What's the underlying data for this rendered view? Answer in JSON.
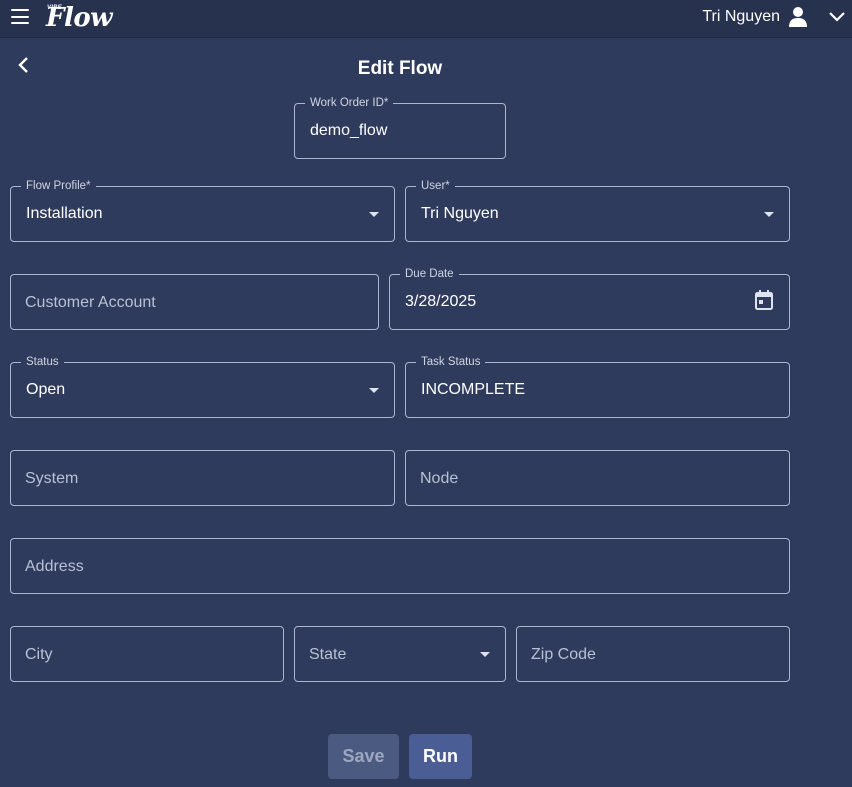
{
  "header": {
    "logo_small": "VIBE",
    "logo_main": "Flow",
    "user_name": "Tri Nguyen"
  },
  "page": {
    "title": "Edit Flow"
  },
  "form": {
    "work_order_id": {
      "label": "Work Order ID*",
      "value": "demo_flow"
    },
    "flow_profile": {
      "label": "Flow Profile*",
      "value": "Installation"
    },
    "user": {
      "label": "User*",
      "value": "Tri Nguyen"
    },
    "customer_account": {
      "placeholder": "Customer Account"
    },
    "due_date": {
      "label": "Due Date",
      "value": "3/28/2025"
    },
    "status": {
      "label": "Status",
      "value": "Open"
    },
    "task_status": {
      "label": "Task Status",
      "value": "INCOMPLETE"
    },
    "system": {
      "placeholder": "System"
    },
    "node": {
      "placeholder": "Node"
    },
    "address": {
      "placeholder": "Address"
    },
    "city": {
      "placeholder": "City"
    },
    "state": {
      "placeholder": "State"
    },
    "zip_code": {
      "placeholder": "Zip Code"
    }
  },
  "actions": {
    "save_label": "Save",
    "run_label": "Run"
  },
  "icons": {
    "menu": "menu-icon",
    "user": "user-icon",
    "chevron": "chevron-down-icon",
    "back": "back-arrow-icon",
    "calendar": "calendar-icon",
    "dropdown": "caret-down-icon"
  }
}
